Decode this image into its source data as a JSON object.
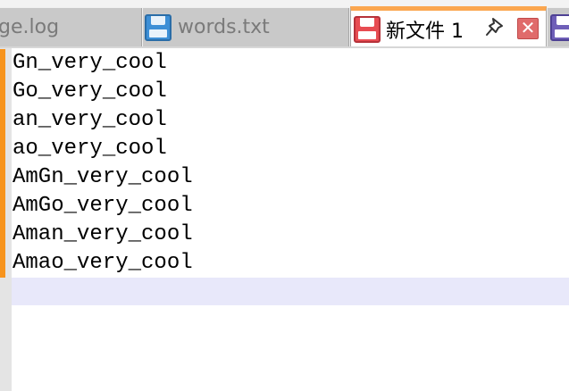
{
  "tabs": [
    {
      "label": "ge.log",
      "icon": "none"
    },
    {
      "label": "words.txt",
      "icon": "floppy-disk-blue-icon"
    },
    {
      "label": "新文件 1",
      "icon": "floppy-disk-red-icon",
      "active": true
    },
    {
      "label": "",
      "icon": "floppy-disk-purple-icon"
    }
  ],
  "tab_controls": {
    "close_glyph": "✕"
  },
  "editor": {
    "lines": [
      "Gn_very_cool",
      "Go_very_cool",
      "an_very_cool",
      "ao_very_cool",
      "AmGn_very_cool",
      "AmGo_very_cool",
      "Aman_very_cool",
      "Amao_very_cool",
      ""
    ],
    "current_line_index": 8
  },
  "colors": {
    "active_tab_accent": "#fba64f",
    "change_marker": "#f7941d",
    "current_line_highlight": "#e8e8fa",
    "close_button": "#e06b6b"
  }
}
